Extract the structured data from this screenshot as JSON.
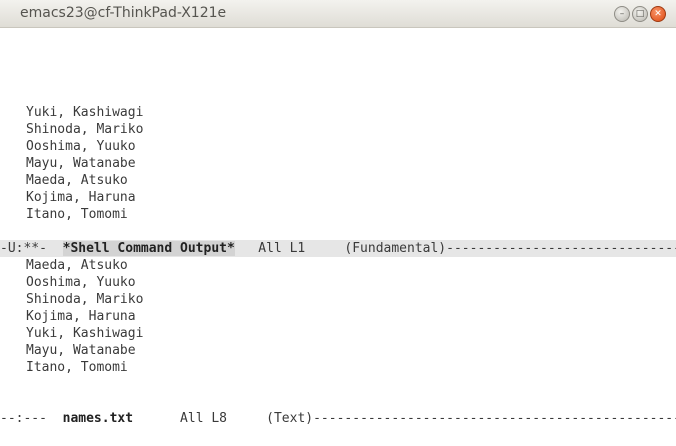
{
  "window": {
    "title": "emacs23@cf-ThinkPad-X121e",
    "min_glyph": "–",
    "max_glyph": "□",
    "close_glyph": "✕"
  },
  "top_pane": {
    "lines": [
      "Yuki, Kashiwagi",
      "Shinoda, Mariko",
      "Ooshima, Yuuko",
      "Mayu, Watanabe",
      "Maeda, Atsuko",
      "Kojima, Haruna",
      "Itano, Tomomi"
    ],
    "modeline": {
      "prefix": "-U:**-  ",
      "buffer": "*Shell Command Output*",
      "position": "   All L1     ",
      "mode": "(Fundamental)",
      "dashes": "------------------------------------------------------------"
    }
  },
  "bottom_pane": {
    "lines": [
      "Maeda, Atsuko",
      "Ooshima, Yuuko",
      "Shinoda, Mariko",
      "Kojima, Haruna",
      "Yuki, Kashiwagi",
      "Mayu, Watanabe",
      "Itano, Tomomi"
    ],
    "modeline": {
      "prefix": "--:---  ",
      "buffer": "names.txt",
      "position": "      All L8     ",
      "mode": "(Text)",
      "dashes": "----------------------------------------------------------------------"
    }
  }
}
